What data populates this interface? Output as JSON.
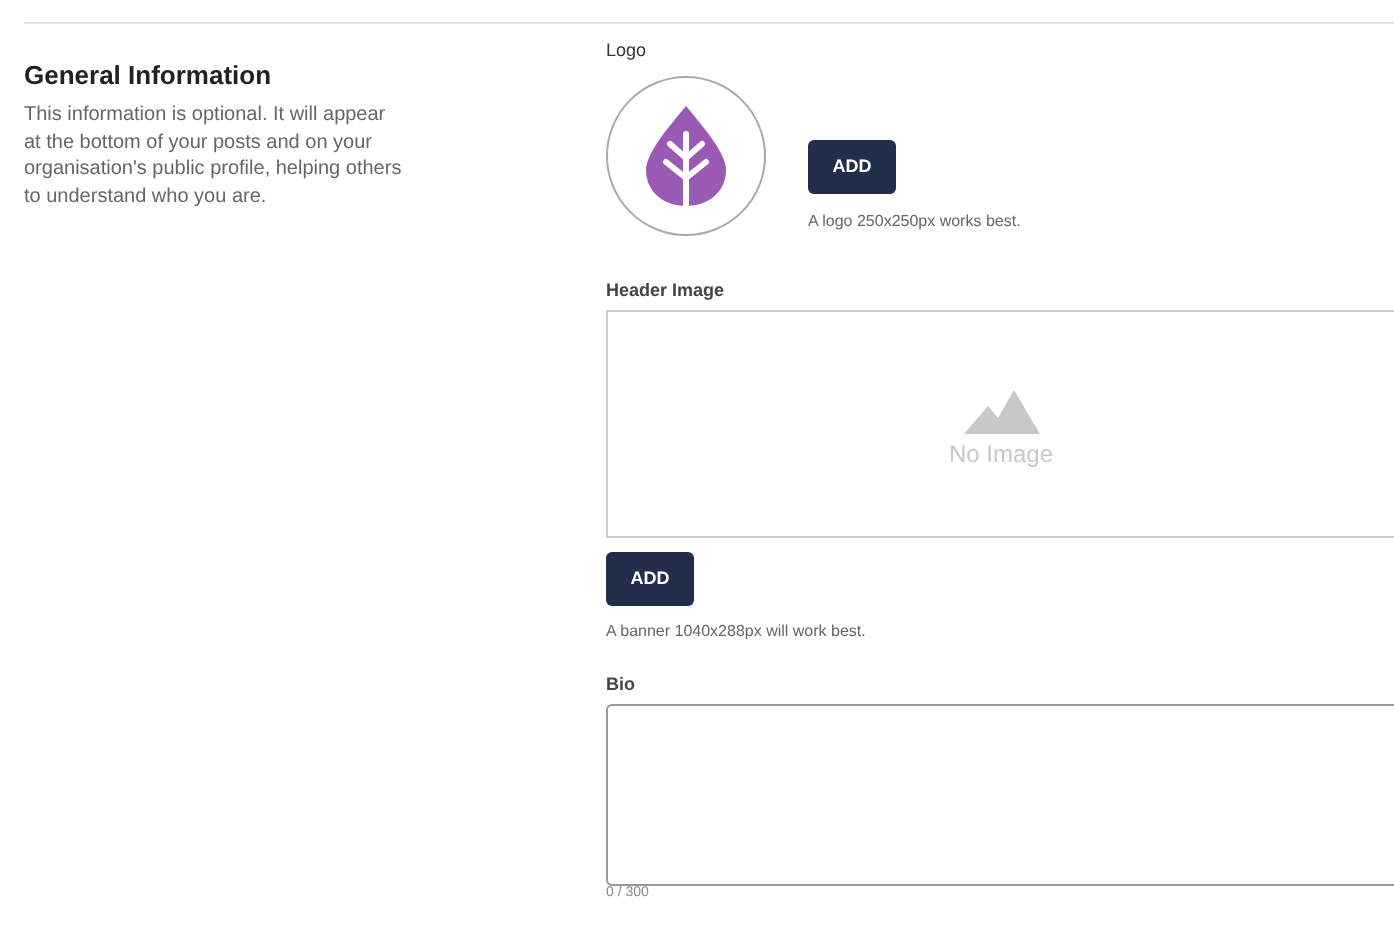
{
  "section": {
    "title": "General Information",
    "description": "This information is optional. It will appear at the bottom of your posts and on your organisation's public profile, helping others to understand who you are."
  },
  "logo": {
    "label": "Logo",
    "button": "ADD",
    "hint": "A logo 250x250px works best."
  },
  "header_image": {
    "label": "Header Image",
    "placeholder_text": "No Image",
    "button": "ADD",
    "hint": "A banner 1040x288px will work best."
  },
  "bio": {
    "label": "Bio",
    "counter": "0 / 300"
  }
}
